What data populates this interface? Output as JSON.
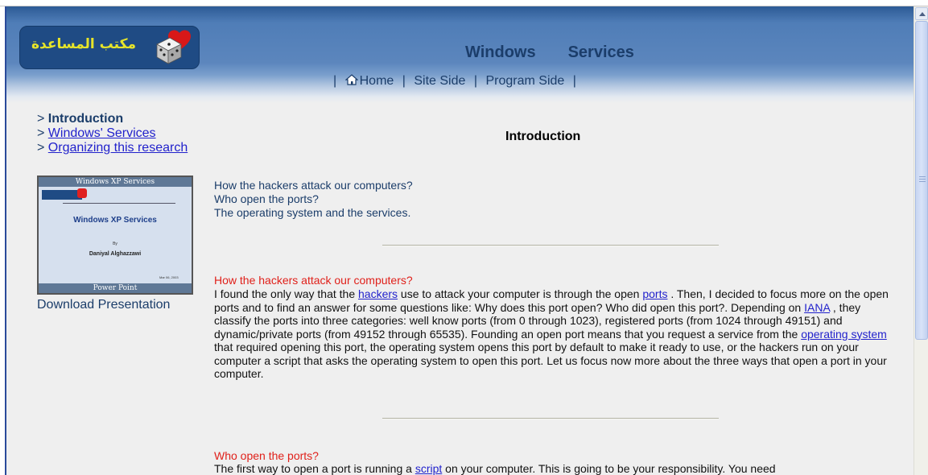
{
  "header": {
    "logo_text": "مكتب المساعدة",
    "title_word1": "Windows",
    "title_word2": "Services"
  },
  "topnav": {
    "home": "Home",
    "site_side": "Site Side",
    "program_side": "Program Side",
    "separator": "|"
  },
  "sidenav": {
    "items": [
      {
        "prefix": "> ",
        "label": "Introduction",
        "current": true
      },
      {
        "prefix": "> ",
        "label": "Windows' Services",
        "current": false
      },
      {
        "prefix": "> ",
        "label": "Organizing this research",
        "current": false
      }
    ]
  },
  "presentation": {
    "title_bar": "Windows XP Services",
    "main_title": "Windows XP Services",
    "by": "By",
    "author": "Daniyal Alghazzawi",
    "date": "Mar 06, 2003",
    "bottom_bar": "Power Point",
    "download_label": "Download Presentation"
  },
  "main": {
    "title": "Introduction",
    "toc": [
      "How the hackers attack our computers?",
      "Who open the ports?",
      "The operating system and the services."
    ],
    "section1": {
      "title": "How the hackers attack our computers?",
      "t1": "I found the only way that the ",
      "l1": "hackers",
      "t2": " use to attack your computer is through the open ",
      "l2": "ports",
      "t3": " . Then, I decided to focus more on the open ports and to find an answer for some questions like: Why does this port open? Who did open this port?. Depending on ",
      "l3": "IANA",
      "t4": " , they classify the ports into three categories: well know ports (from 0 through 1023), registered ports (from 1024 through 49151) and dynamic/private ports (from 49152 through 65535). Founding an open port means that you request a service from the ",
      "l4": "operating system",
      "t5": " that required opening this port, the operating system opens this port by default to make it ready to use, or the hackers run on your computer a script that asks the operating system to open this port. Let us focus now more about the three ways that open a port in your computer."
    },
    "section2": {
      "title": "Who open the ports?",
      "t1": "The first way to open a port is running a ",
      "l1": "script",
      "t2": " on your computer. This is going to be your responsibility. You need"
    }
  },
  "colors": {
    "header_dark": "#2c5a95",
    "logo_yellow": "#e6e42a",
    "link_blue": "#2222cc",
    "section_red": "#e0201a",
    "nav_text": "#1b3d6a"
  }
}
